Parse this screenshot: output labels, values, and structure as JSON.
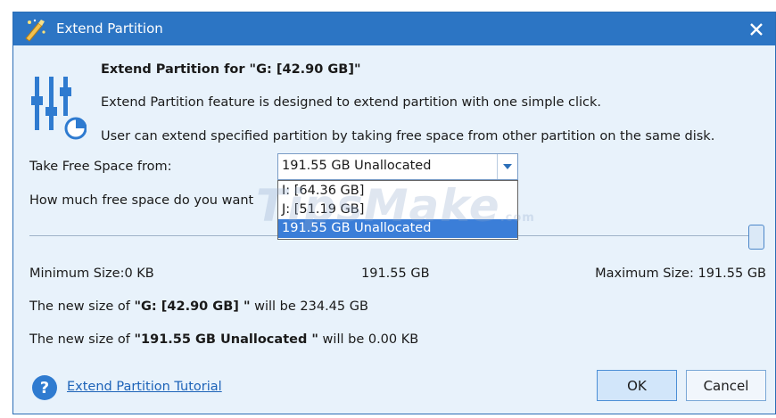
{
  "window": {
    "title": "Extend Partition"
  },
  "header": {
    "heading": "Extend Partition for \"G: [42.90 GB]\"",
    "desc1": "Extend Partition feature is designed to extend partition with one simple click.",
    "desc2": "User can extend specified partition by taking free space from other partition on the same disk."
  },
  "form": {
    "take_label": "Take Free Space from:",
    "selected": "191.55 GB Unallocated",
    "options": [
      "I:  [64.36 GB]",
      "J:  [51.19 GB]",
      "191.55 GB Unallocated"
    ],
    "how_label": "How much free space do you want"
  },
  "watermark": {
    "text": "TipsMake",
    "suffix": ".com"
  },
  "slider": {
    "value_fraction": 1.0
  },
  "sizes": {
    "min": "Minimum Size:0 KB",
    "current": "191.55 GB",
    "max": "Maximum Size: 191.55 GB"
  },
  "result": {
    "g_prefix": "The new size of ",
    "g_name": "\"G: [42.90 GB] \"",
    "g_suffix": " will be 234.45 GB",
    "u_prefix": "The new size of ",
    "u_name": "\"191.55 GB Unallocated \"",
    "u_suffix": " will be 0.00 KB"
  },
  "footer": {
    "help_link": "Extend Partition Tutorial",
    "ok_label": "OK",
    "cancel_label": "Cancel"
  },
  "colors": {
    "titlebar": "#2c75c4",
    "dialog_bg": "#e8f2fb",
    "selection": "#3b7ed8",
    "link": "#1d63b8"
  }
}
